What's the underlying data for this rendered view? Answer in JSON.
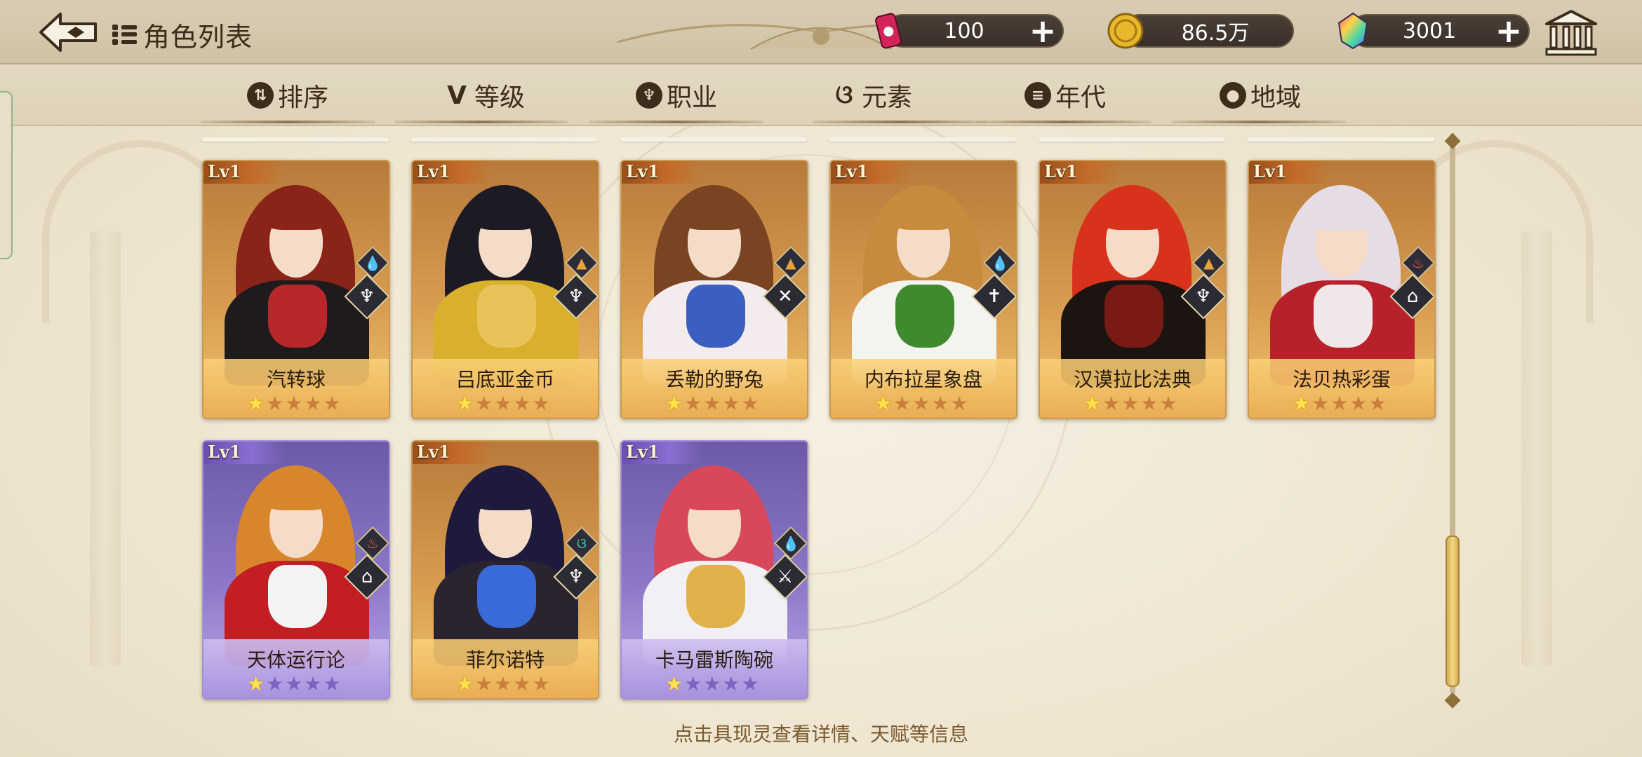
{
  "header": {
    "title": "角色列表",
    "back_icon": "back-arrow-icon",
    "list_icon": "list-icon"
  },
  "currencies": [
    {
      "name": "stamina",
      "icon": "soda-can-icon",
      "value": "100",
      "has_plus": true
    },
    {
      "name": "gold",
      "icon": "gold-coin-icon",
      "value": "86.5万",
      "has_plus": false
    },
    {
      "name": "crystal",
      "icon": "rainbow-gem-icon",
      "value": "3001",
      "has_plus": true
    }
  ],
  "museum_icon": "museum-icon",
  "tabs": [
    {
      "label": "排序",
      "icon": "sort-icon",
      "glyph": "⇅"
    },
    {
      "label": "等级",
      "icon": "level-v-icon",
      "glyph": "V"
    },
    {
      "label": "职业",
      "icon": "class-trident-icon",
      "glyph": "♆"
    },
    {
      "label": "元素",
      "icon": "element-swirl-icon",
      "glyph": "ଓ"
    },
    {
      "label": "年代",
      "icon": "era-icon",
      "glyph": "≡"
    },
    {
      "label": "地域",
      "icon": "location-pin-icon",
      "glyph": "●"
    }
  ],
  "cards": [
    {
      "level": "Lv1",
      "name": "汽转球",
      "stars": 1,
      "max_stars": 5,
      "rarity": "gold",
      "element": "water-drop-icon",
      "class": "trident-icon",
      "colors": {
        "hair": "#8a2418",
        "outfit": "#1f1a1c",
        "accent": "#b8282a"
      }
    },
    {
      "level": "Lv1",
      "name": "吕底亚金币",
      "stars": 1,
      "max_stars": 5,
      "rarity": "gold",
      "element": "earth-mountain-icon",
      "class": "trident-icon",
      "colors": {
        "hair": "#1c1a24",
        "outfit": "#d8b02c",
        "accent": "#e7c35a"
      }
    },
    {
      "level": "Lv1",
      "name": "丢勒的野兔",
      "stars": 1,
      "max_stars": 5,
      "rarity": "gold",
      "element": "earth-mountain-icon",
      "class": "crossed-tools-icon",
      "colors": {
        "hair": "#7a4422",
        "outfit": "#f4ecec",
        "accent": "#3a5fc0"
      }
    },
    {
      "level": "Lv1",
      "name": "内布拉星象盘",
      "stars": 1,
      "max_stars": 5,
      "rarity": "gold",
      "element": "water-drop-icon",
      "class": "cross-staff-icon",
      "colors": {
        "hair": "#c88a3c",
        "outfit": "#f4f4ee",
        "accent": "#3f8a2e"
      }
    },
    {
      "level": "Lv1",
      "name": "汉谟拉比法典",
      "stars": 1,
      "max_stars": 5,
      "rarity": "gold",
      "element": "earth-mountain-icon",
      "class": "trident-icon",
      "colors": {
        "hair": "#d8321c",
        "outfit": "#1c1410",
        "accent": "#7a1a14"
      }
    },
    {
      "level": "Lv1",
      "name": "法贝热彩蛋",
      "stars": 1,
      "max_stars": 5,
      "rarity": "gold",
      "element": "fire-icon",
      "class": "book-icon",
      "colors": {
        "hair": "#e6dce6",
        "outfit": "#b8202a",
        "accent": "#f0e8e8"
      }
    },
    {
      "level": "Lv1",
      "name": "天体运行论",
      "stars": 1,
      "max_stars": 5,
      "rarity": "purple",
      "element": "fire-icon",
      "class": "book-icon",
      "colors": {
        "hair": "#d8862c",
        "outfit": "#c21e24",
        "accent": "#f4f4f4"
      }
    },
    {
      "level": "Lv1",
      "name": "菲尔诺特",
      "stars": 1,
      "max_stars": 5,
      "rarity": "gold",
      "element": "wind-swirl-icon",
      "class": "trident-icon",
      "colors": {
        "hair": "#1e1a3c",
        "outfit": "#2a2430",
        "accent": "#3a6ad8"
      }
    },
    {
      "level": "Lv1",
      "name": "卡马雷斯陶碗",
      "stars": 1,
      "max_stars": 5,
      "rarity": "purple",
      "element": "water-drop-icon",
      "class": "sword-wings-icon",
      "colors": {
        "hair": "#d8485a",
        "outfit": "#f2f0f4",
        "accent": "#e2b24a"
      }
    }
  ],
  "hint": "点击具现灵查看详情、天赋等信息"
}
